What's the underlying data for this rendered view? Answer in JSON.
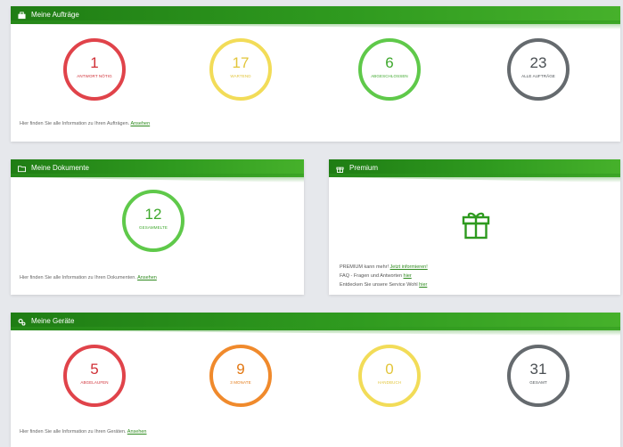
{
  "colors": {
    "header_green": "#2f9a1f",
    "red": "#e0434a",
    "yellow": "#f2dc58",
    "green": "#5fc94a",
    "gray": "#656a6e",
    "orange": "#f08a2c",
    "link": "#2e8a1e"
  },
  "orders": {
    "title": "Meine Aufträge",
    "icon": "briefcase-icon",
    "stats": [
      {
        "value": "1",
        "label": "ANTWORT NÖTIG"
      },
      {
        "value": "17",
        "label": "WARTEND"
      },
      {
        "value": "6",
        "label": "ABGESCHLOSSEN"
      },
      {
        "value": "23",
        "label": "ALLE AUFTRÄGE"
      }
    ],
    "info_text": "Hier finden Sie alle Information zu Ihren Aufträgen.",
    "link": "Ansehen"
  },
  "documents": {
    "title": "Meine Dokumente",
    "icon": "folder-icon",
    "stats": [
      {
        "value": "12",
        "label": "GESAMMELTE"
      }
    ],
    "info_text": "Hier finden Sie alle Information zu Ihren Dokumenten.",
    "link": "Ansehen"
  },
  "premium": {
    "title": "Premium",
    "icon": "gift-icon",
    "line1_text": "PREMIUM kann mehr!",
    "line1_link": "Jetzt informieren!",
    "line2_text": "FAQ - Fragen und Antworten",
    "line2_link": "hier",
    "line3_text": "Entdecken Sie unsere Service Wohl",
    "line3_link": "hier"
  },
  "devices": {
    "title": "Meine Geräte",
    "icon": "gears-icon",
    "stats": [
      {
        "value": "5",
        "label": "ABGELAUFEN"
      },
      {
        "value": "9",
        "label": "3 MONATE"
      },
      {
        "value": "0",
        "label": "HANDBUCH"
      },
      {
        "value": "31",
        "label": "GESAMT"
      }
    ],
    "info_text": "Hier finden Sie alle Information zu Ihren Geräten.",
    "link": "Ansehen"
  }
}
